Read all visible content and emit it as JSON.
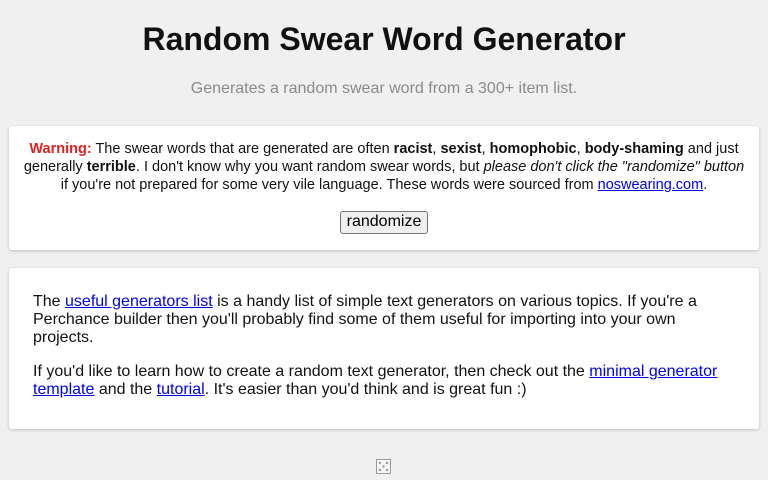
{
  "header": {
    "title": "Random Swear Word Generator",
    "subtitle": "Generates a random swear word from a 300+ item list."
  },
  "warning": {
    "label": "Warning:",
    "text_1": " The swear words that are generated are often ",
    "word_racist": "racist",
    "sep_1": ", ",
    "word_sexist": "sexist",
    "sep_2": ", ",
    "word_homophobic": "homophobic",
    "sep_3": ", ",
    "word_body_shaming": "body-shaming",
    "text_2": " and just generally ",
    "word_terrible": "terrible",
    "text_3": ". I don't know why you want random swear words, but ",
    "emphasis": "please don't click the \"randomize\" button",
    "text_4": " if you're not prepared for some very vile language. These words were sourced from ",
    "source_link": "noswearing.com",
    "text_5": ".",
    "accent_color": "#e02020"
  },
  "randomize_button": {
    "label": "randomize"
  },
  "info": {
    "p1_start": "The ",
    "p1_link": "useful generators list",
    "p1_end": " is a handy list of simple text generators on various topics. If you're a Perchance builder then you'll probably find some of them useful for importing into your own projects.",
    "p2_start": "If you'd like to learn how to create a random text generator, then check out the ",
    "p2_link_template": "minimal generator template",
    "p2_mid": " and the ",
    "p2_link_tutorial": "tutorial",
    "p2_end": ". It's easier than you'd think and is great fun :)",
    "link_color": "#0000ee"
  },
  "footer": {
    "icon": "dice-icon"
  }
}
